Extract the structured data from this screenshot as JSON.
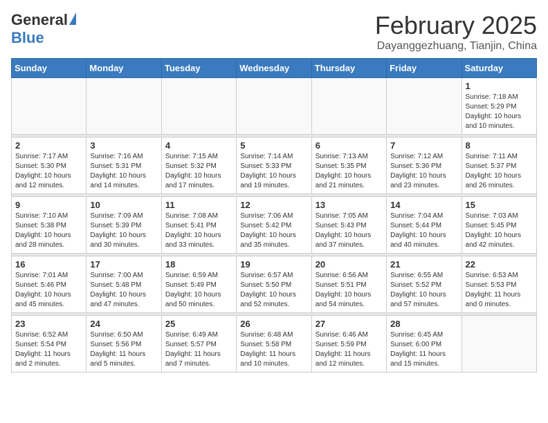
{
  "header": {
    "logo_general": "General",
    "logo_blue": "Blue",
    "title": "February 2025",
    "subtitle": "Dayanggezhuang, Tianjin, China"
  },
  "days_of_week": [
    "Sunday",
    "Monday",
    "Tuesday",
    "Wednesday",
    "Thursday",
    "Friday",
    "Saturday"
  ],
  "weeks": [
    [
      {
        "day": "",
        "info": ""
      },
      {
        "day": "",
        "info": ""
      },
      {
        "day": "",
        "info": ""
      },
      {
        "day": "",
        "info": ""
      },
      {
        "day": "",
        "info": ""
      },
      {
        "day": "",
        "info": ""
      },
      {
        "day": "1",
        "info": "Sunrise: 7:18 AM\nSunset: 5:29 PM\nDaylight: 10 hours\nand 10 minutes."
      }
    ],
    [
      {
        "day": "2",
        "info": "Sunrise: 7:17 AM\nSunset: 5:30 PM\nDaylight: 10 hours\nand 12 minutes."
      },
      {
        "day": "3",
        "info": "Sunrise: 7:16 AM\nSunset: 5:31 PM\nDaylight: 10 hours\nand 14 minutes."
      },
      {
        "day": "4",
        "info": "Sunrise: 7:15 AM\nSunset: 5:32 PM\nDaylight: 10 hours\nand 17 minutes."
      },
      {
        "day": "5",
        "info": "Sunrise: 7:14 AM\nSunset: 5:33 PM\nDaylight: 10 hours\nand 19 minutes."
      },
      {
        "day": "6",
        "info": "Sunrise: 7:13 AM\nSunset: 5:35 PM\nDaylight: 10 hours\nand 21 minutes."
      },
      {
        "day": "7",
        "info": "Sunrise: 7:12 AM\nSunset: 5:36 PM\nDaylight: 10 hours\nand 23 minutes."
      },
      {
        "day": "8",
        "info": "Sunrise: 7:11 AM\nSunset: 5:37 PM\nDaylight: 10 hours\nand 26 minutes."
      }
    ],
    [
      {
        "day": "9",
        "info": "Sunrise: 7:10 AM\nSunset: 5:38 PM\nDaylight: 10 hours\nand 28 minutes."
      },
      {
        "day": "10",
        "info": "Sunrise: 7:09 AM\nSunset: 5:39 PM\nDaylight: 10 hours\nand 30 minutes."
      },
      {
        "day": "11",
        "info": "Sunrise: 7:08 AM\nSunset: 5:41 PM\nDaylight: 10 hours\nand 33 minutes."
      },
      {
        "day": "12",
        "info": "Sunrise: 7:06 AM\nSunset: 5:42 PM\nDaylight: 10 hours\nand 35 minutes."
      },
      {
        "day": "13",
        "info": "Sunrise: 7:05 AM\nSunset: 5:43 PM\nDaylight: 10 hours\nand 37 minutes."
      },
      {
        "day": "14",
        "info": "Sunrise: 7:04 AM\nSunset: 5:44 PM\nDaylight: 10 hours\nand 40 minutes."
      },
      {
        "day": "15",
        "info": "Sunrise: 7:03 AM\nSunset: 5:45 PM\nDaylight: 10 hours\nand 42 minutes."
      }
    ],
    [
      {
        "day": "16",
        "info": "Sunrise: 7:01 AM\nSunset: 5:46 PM\nDaylight: 10 hours\nand 45 minutes."
      },
      {
        "day": "17",
        "info": "Sunrise: 7:00 AM\nSunset: 5:48 PM\nDaylight: 10 hours\nand 47 minutes."
      },
      {
        "day": "18",
        "info": "Sunrise: 6:59 AM\nSunset: 5:49 PM\nDaylight: 10 hours\nand 50 minutes."
      },
      {
        "day": "19",
        "info": "Sunrise: 6:57 AM\nSunset: 5:50 PM\nDaylight: 10 hours\nand 52 minutes."
      },
      {
        "day": "20",
        "info": "Sunrise: 6:56 AM\nSunset: 5:51 PM\nDaylight: 10 hours\nand 54 minutes."
      },
      {
        "day": "21",
        "info": "Sunrise: 6:55 AM\nSunset: 5:52 PM\nDaylight: 10 hours\nand 57 minutes."
      },
      {
        "day": "22",
        "info": "Sunrise: 6:53 AM\nSunset: 5:53 PM\nDaylight: 11 hours\nand 0 minutes."
      }
    ],
    [
      {
        "day": "23",
        "info": "Sunrise: 6:52 AM\nSunset: 5:54 PM\nDaylight: 11 hours\nand 2 minutes."
      },
      {
        "day": "24",
        "info": "Sunrise: 6:50 AM\nSunset: 5:56 PM\nDaylight: 11 hours\nand 5 minutes."
      },
      {
        "day": "25",
        "info": "Sunrise: 6:49 AM\nSunset: 5:57 PM\nDaylight: 11 hours\nand 7 minutes."
      },
      {
        "day": "26",
        "info": "Sunrise: 6:48 AM\nSunset: 5:58 PM\nDaylight: 11 hours\nand 10 minutes."
      },
      {
        "day": "27",
        "info": "Sunrise: 6:46 AM\nSunset: 5:59 PM\nDaylight: 11 hours\nand 12 minutes."
      },
      {
        "day": "28",
        "info": "Sunrise: 6:45 AM\nSunset: 6:00 PM\nDaylight: 11 hours\nand 15 minutes."
      },
      {
        "day": "",
        "info": ""
      }
    ]
  ]
}
